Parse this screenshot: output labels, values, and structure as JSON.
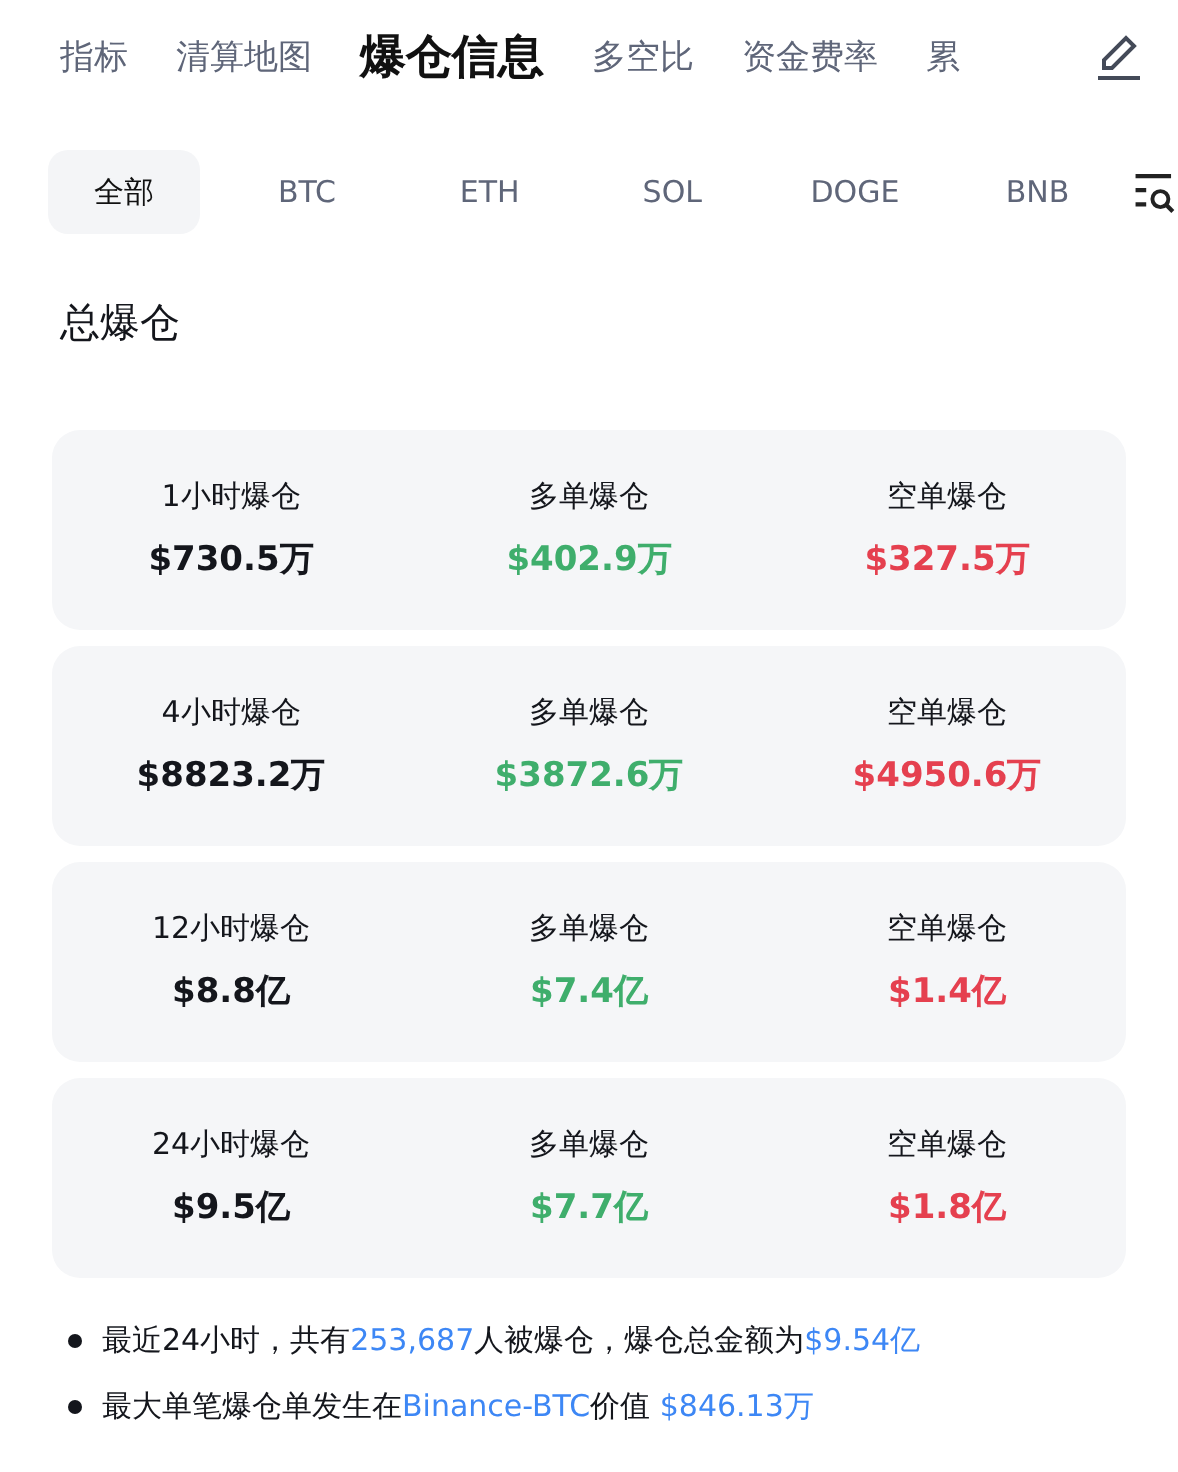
{
  "top_tabs": [
    {
      "label": "指标",
      "selected": false
    },
    {
      "label": "清算地图",
      "selected": false
    },
    {
      "label": "爆仓信息",
      "selected": true
    },
    {
      "label": "多空比",
      "selected": false
    },
    {
      "label": "资金费率",
      "selected": false
    },
    {
      "label": "累",
      "selected": false
    }
  ],
  "coin_tabs": [
    {
      "label": "全部",
      "selected": true
    },
    {
      "label": "BTC",
      "selected": false
    },
    {
      "label": "ETH",
      "selected": false
    },
    {
      "label": "SOL",
      "selected": false
    },
    {
      "label": "DOGE",
      "selected": false
    },
    {
      "label": "BNB",
      "selected": false
    }
  ],
  "section_title": "总爆仓",
  "cards": [
    {
      "stats": [
        {
          "label": "1小时爆仓",
          "value": "$730.5万",
          "kind": "total"
        },
        {
          "label": "多单爆仓",
          "value": "$402.9万",
          "kind": "long"
        },
        {
          "label": "空单爆仓",
          "value": "$327.5万",
          "kind": "short"
        }
      ]
    },
    {
      "stats": [
        {
          "label": "4小时爆仓",
          "value": "$8823.2万",
          "kind": "total"
        },
        {
          "label": "多单爆仓",
          "value": "$3872.6万",
          "kind": "long"
        },
        {
          "label": "空单爆仓",
          "value": "$4950.6万",
          "kind": "short"
        }
      ]
    },
    {
      "stats": [
        {
          "label": "12小时爆仓",
          "value": "$8.8亿",
          "kind": "total"
        },
        {
          "label": "多单爆仓",
          "value": "$7.4亿",
          "kind": "long"
        },
        {
          "label": "空单爆仓",
          "value": "$1.4亿",
          "kind": "short"
        }
      ]
    },
    {
      "stats": [
        {
          "label": "24小时爆仓",
          "value": "$9.5亿",
          "kind": "total"
        },
        {
          "label": "多单爆仓",
          "value": "$7.7亿",
          "kind": "long"
        },
        {
          "label": "空单爆仓",
          "value": "$1.8亿",
          "kind": "short"
        }
      ]
    }
  ],
  "notes": [
    [
      {
        "text": "最近24小时，共有",
        "kind": "plain"
      },
      {
        "text": "253,687",
        "kind": "highlight"
      },
      {
        "text": "人被爆仓，爆仓总金额为",
        "kind": "plain"
      },
      {
        "text": "$9.54亿",
        "kind": "highlight"
      }
    ],
    [
      {
        "text": "最大单笔爆仓单发生在",
        "kind": "plain"
      },
      {
        "text": "Binance-BTC",
        "kind": "highlight"
      },
      {
        "text": "价值 ",
        "kind": "plain"
      },
      {
        "text": "$846.13万",
        "kind": "highlight"
      }
    ]
  ]
}
